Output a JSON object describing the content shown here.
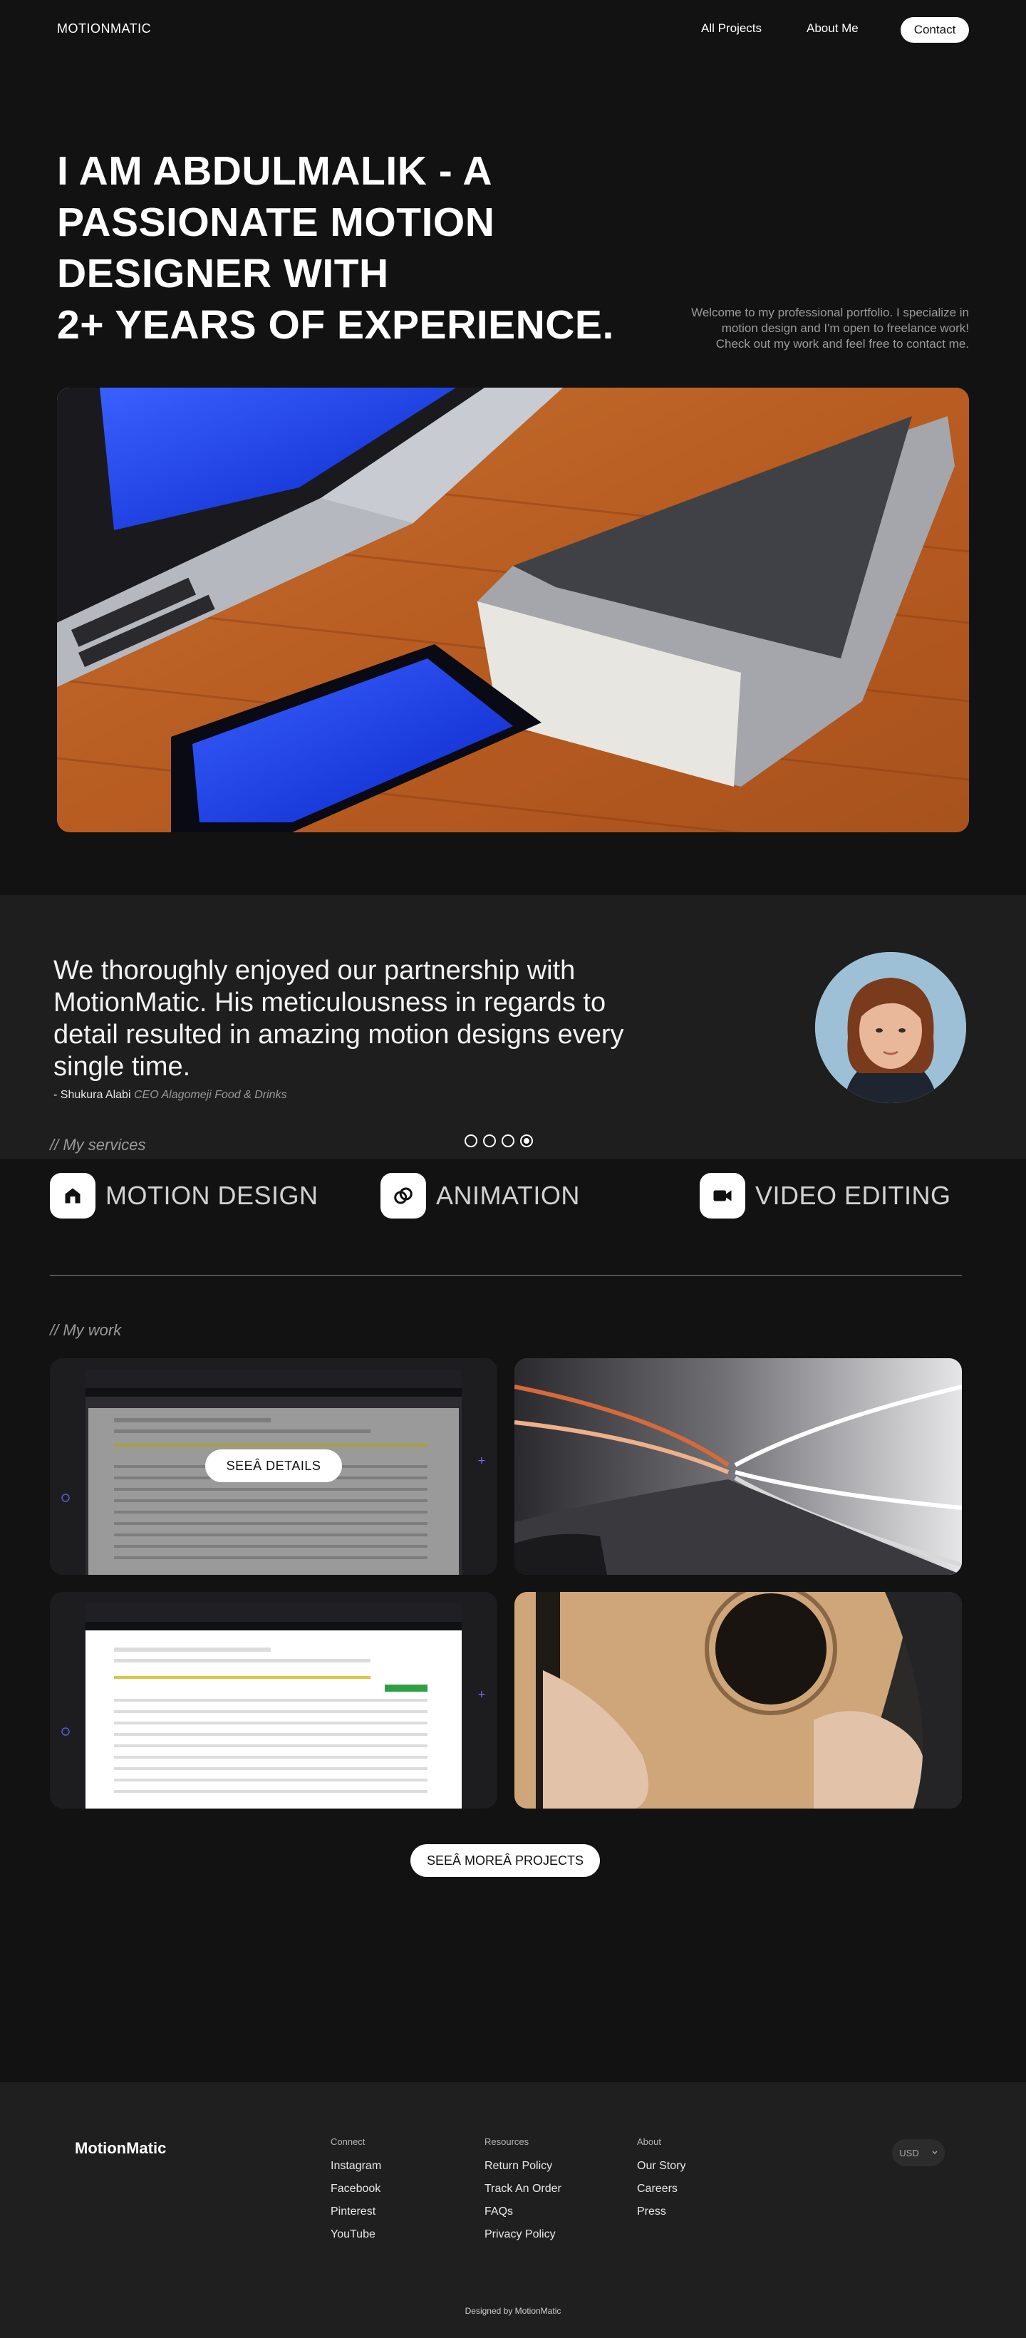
{
  "nav": {
    "brand": "MOTIONMATIC",
    "links": [
      "All Projects",
      "About Me"
    ],
    "contact_label": "Contact"
  },
  "hero": {
    "title_lines": [
      "I AM ABDULMALIK - A",
      "PASSIONATE MOTION",
      "DESIGNER WITH",
      "2+ YEARS OF EXPERIENCE."
    ],
    "description": "Welcome to my professional portfolio. I specialize in motion design and I'm open to freelance work! Check out my work and feel free to contact me."
  },
  "testimonial": {
    "quote": "We thoroughly enjoyed our partnership with MotionMatic. His meticulousness in regards to detail resulted in amazing motion designs every single time.",
    "author_name": "- Shukura Alabi",
    "author_role": "CEO Alagomeji Food & Drinks",
    "slides_total": 4,
    "active_slide": 4
  },
  "services": {
    "heading": "// My services",
    "items": [
      {
        "label": "MOTION DESIGN",
        "icon": "house-icon"
      },
      {
        "label": "ANIMATION",
        "icon": "rings-icon"
      },
      {
        "label": "VIDEO EDITING",
        "icon": "video-camera-icon"
      }
    ]
  },
  "work": {
    "heading": "// My work",
    "details_label": "SEEÂ DETAILS",
    "more_label": "SEEÂ MOREÂ PROJECTS"
  },
  "footer": {
    "brand": "MotionMatic",
    "columns": [
      {
        "heading": "Connect",
        "items": [
          "Instagram",
          "Facebook",
          "Pinterest",
          "YouTube"
        ]
      },
      {
        "heading": "Resources",
        "items": [
          "Return Policy",
          "Track An Order",
          "FAQs",
          "Privacy Policy"
        ]
      },
      {
        "heading": "About",
        "items": [
          "Our Story",
          "Careers",
          "Press"
        ]
      }
    ],
    "currency": "USD",
    "credit": "Designed by MotionMatic"
  },
  "colors": {
    "background": "#121212",
    "panel": "#1e1e1e",
    "accent": "#ffffff",
    "muted_text": "#9b9b9b"
  }
}
